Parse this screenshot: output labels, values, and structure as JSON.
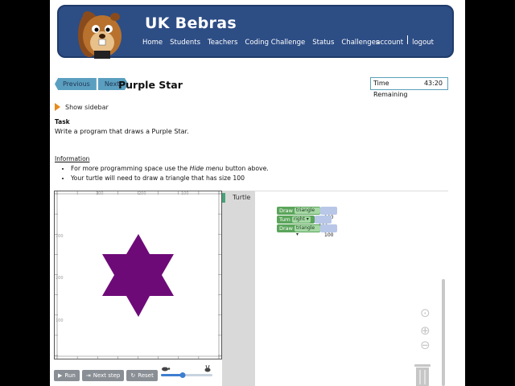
{
  "header": {
    "brand": "UK Bebras",
    "nav": [
      "Home",
      "Students",
      "Teachers",
      "Coding Challenge",
      "Status",
      "Challenges"
    ],
    "nav_right": [
      "account",
      "logout"
    ]
  },
  "task": {
    "prev_label": "Previous",
    "next_label": "Next",
    "title": "Purple Star",
    "timer_label": "Time Remaining",
    "timer_value": "43:20",
    "sidebar_toggle": "Show sidebar",
    "task_heading": "Task",
    "task_text": "Write a program that draws a Purple Star.",
    "info_heading": "Information",
    "info_items": [
      {
        "pre": "For more programming space use the ",
        "em": "Hide menu",
        "post": " button above."
      },
      {
        "pre": "Your turtle will need to draw a triangle that has size 100",
        "em": "",
        "post": ""
      }
    ]
  },
  "canvas": {
    "x_ticks": [
      "100",
      "200",
      "100",
      "200"
    ],
    "y_ticks": [
      "100",
      "200",
      "100"
    ],
    "star_color": "#6e0a78"
  },
  "controls": {
    "run": "Run",
    "next_step": "Next step",
    "reset": "Reset",
    "speed_slow_icon": "turtle-icon",
    "speed_fast_icon": "rabbit-icon"
  },
  "workspace": {
    "toolbox_label": "Turtle",
    "blocks": [
      {
        "verb": "Draw",
        "shape": "triangle",
        "value": "100"
      },
      {
        "verb": "Turn",
        "shape": "right",
        "value": "180"
      },
      {
        "verb": "Draw",
        "shape": "triangle",
        "value": "100"
      }
    ]
  },
  "colors": {
    "banner": "#2d4d85",
    "block_green": "#5ba55b",
    "pager_blue": "#5b9fc0"
  }
}
